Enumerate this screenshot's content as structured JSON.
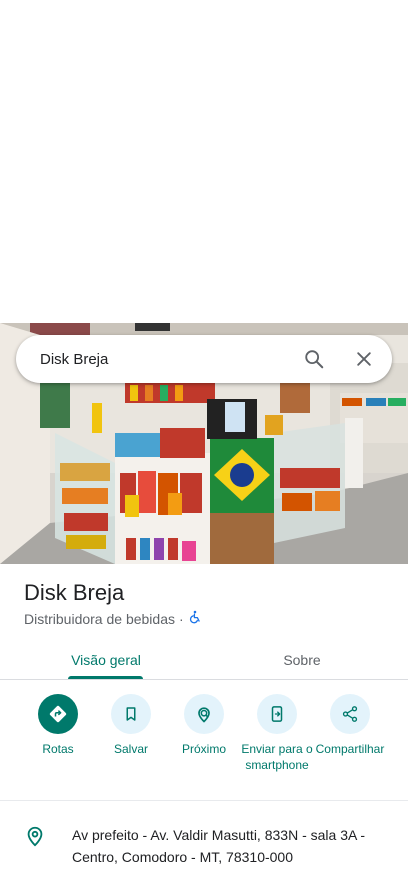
{
  "search": {
    "query": "Disk Breja"
  },
  "place": {
    "name": "Disk Breja",
    "category": "Distribuidora de bebidas",
    "separator": "·"
  },
  "tabs": [
    {
      "label": "Visão geral",
      "active": true
    },
    {
      "label": "Sobre",
      "active": false
    }
  ],
  "actions": [
    {
      "label": "Rotas",
      "icon": "directions-icon"
    },
    {
      "label": "Salvar",
      "icon": "bookmark-icon"
    },
    {
      "label": "Próximo",
      "icon": "nearby-icon"
    },
    {
      "label": "Enviar para o smartphone",
      "icon": "send-to-phone-icon"
    },
    {
      "label": "Compartilhar",
      "icon": "share-icon"
    }
  ],
  "address": {
    "line1": "Av prefeito - Av. Valdir Masutti, 833N - sala 3A -",
    "line2": "Centro, Comodoro - MT, 78310-000"
  },
  "colors": {
    "accent": "#00796b",
    "action_bg": "#e3f3fb",
    "text": "#202124",
    "secondary_text": "#5f6368"
  }
}
